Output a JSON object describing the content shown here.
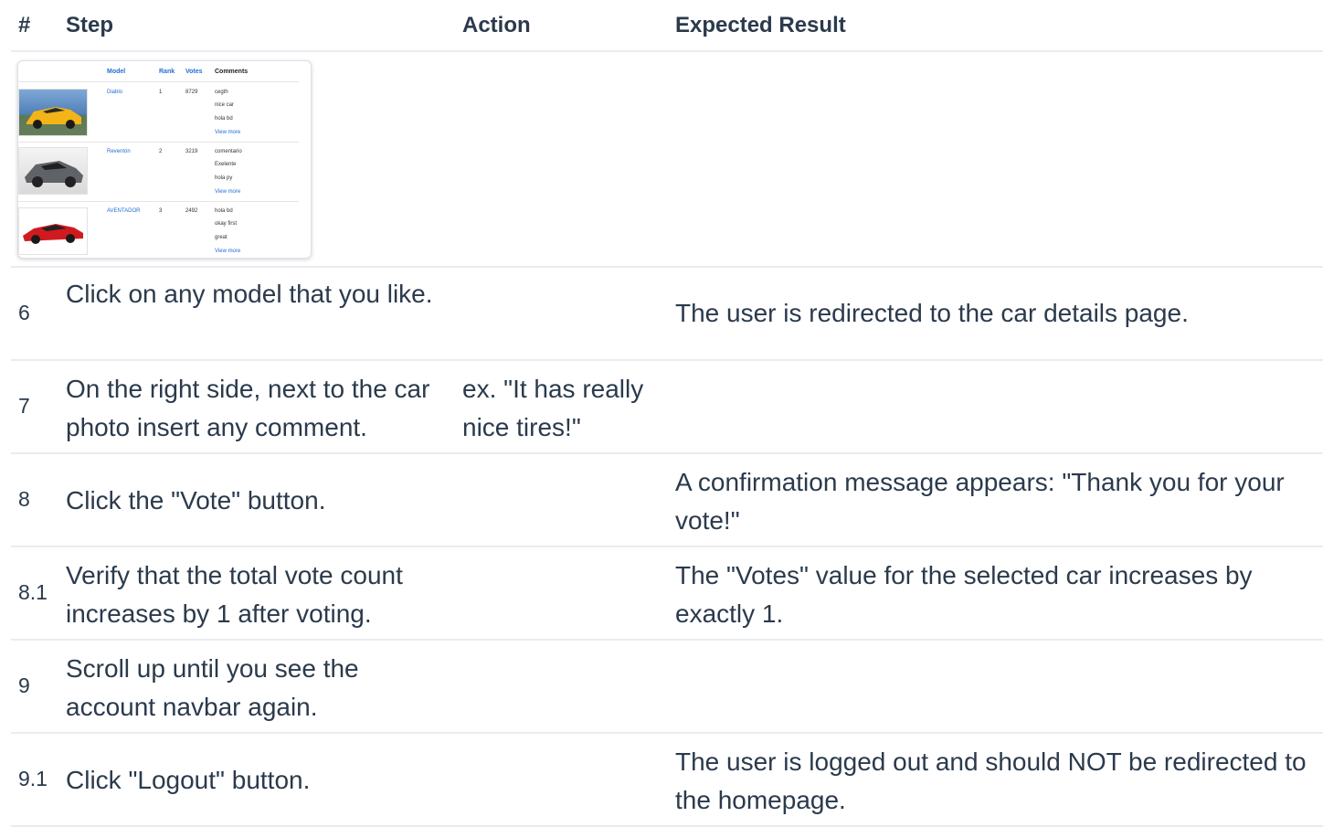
{
  "headers": {
    "num": "#",
    "step": "Step",
    "action": "Action",
    "expected": "Expected Result"
  },
  "screenshot": {
    "headers": {
      "model": "Model",
      "rank": "Rank",
      "votes": "Votes",
      "comments": "Comments"
    },
    "rows": [
      {
        "model": "Diablo",
        "rank": "1",
        "votes": "8729",
        "comments": [
          "cegth",
          "nice car",
          "hola bd"
        ],
        "more": "View more",
        "car_color": "#f2b417",
        "bg": "#5b8fc7"
      },
      {
        "model": "Reventón",
        "rank": "2",
        "votes": "3219",
        "comments": [
          "comentario",
          "Exelente",
          "hola py"
        ],
        "more": "View more",
        "car_color": "#6b6e72",
        "bg": "#e8e8e8"
      },
      {
        "model": "AVENTADOR",
        "rank": "3",
        "votes": "2492",
        "comments": [
          "hola bd",
          "okay first",
          "great"
        ],
        "more": "View more",
        "car_color": "#d11a1f",
        "bg": "#ffffff"
      }
    ]
  },
  "rows": [
    {
      "num": "6",
      "step": "Click on any model that you like.",
      "action": "",
      "expected": "The user is redirected to the car details page."
    },
    {
      "num": "7",
      "step": "On the right side, next to the car photo insert any comment.",
      "action": "ex. \"It has really nice tires!\"",
      "expected": ""
    },
    {
      "num": "8",
      "step": "Click the \"Vote\" button.",
      "action": "",
      "expected": "A confirmation message appears: \"Thank you for your vote!\""
    },
    {
      "num": "8.1",
      "step": "Verify that the total vote count increases by 1 after voting.",
      "action": "",
      "expected": "The \"Votes\" value for the selected car increases by exactly 1."
    },
    {
      "num": "9",
      "step": "Scroll up until you see the account navbar again.",
      "action": "",
      "expected": ""
    },
    {
      "num": "9.1",
      "step": "Click \"Logout\" button.",
      "action": "",
      "expected": "The user is logged out and should NOT be redirected to the homepage."
    }
  ]
}
